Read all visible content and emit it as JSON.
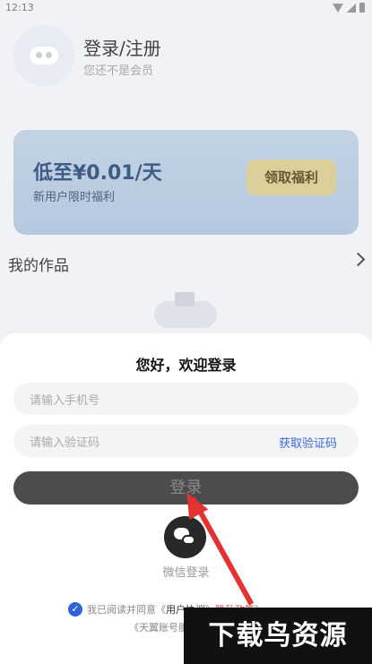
{
  "status": {
    "time": "12:13"
  },
  "profile": {
    "title": "登录/注册",
    "subtitle": "您还不是会员"
  },
  "promo": {
    "price": "低至¥0.01/天",
    "subtitle": "新用户限时福利",
    "button": "领取福利"
  },
  "works": {
    "title": "我的作品"
  },
  "sheet": {
    "title": "您好，欢迎登录",
    "phone_placeholder": "请输入手机号",
    "code_placeholder": "请输入验证码",
    "get_code": "获取验证码",
    "login_button": "登录",
    "wechat_label": "微信登录",
    "agreement_prefix": "我已阅读并同意《",
    "agreement_link1": "用户协议",
    "agreement_sep": "》",
    "agreement_link2": "隐私政策",
    "agreement_suffix": "》",
    "agreement_line2": "《天翼账号服务协议》"
  },
  "watermark": "下载鸟资源",
  "colors": {
    "primary": "#2f63d9",
    "login_button": "#4c4c4c",
    "arrow": "#e23232"
  }
}
